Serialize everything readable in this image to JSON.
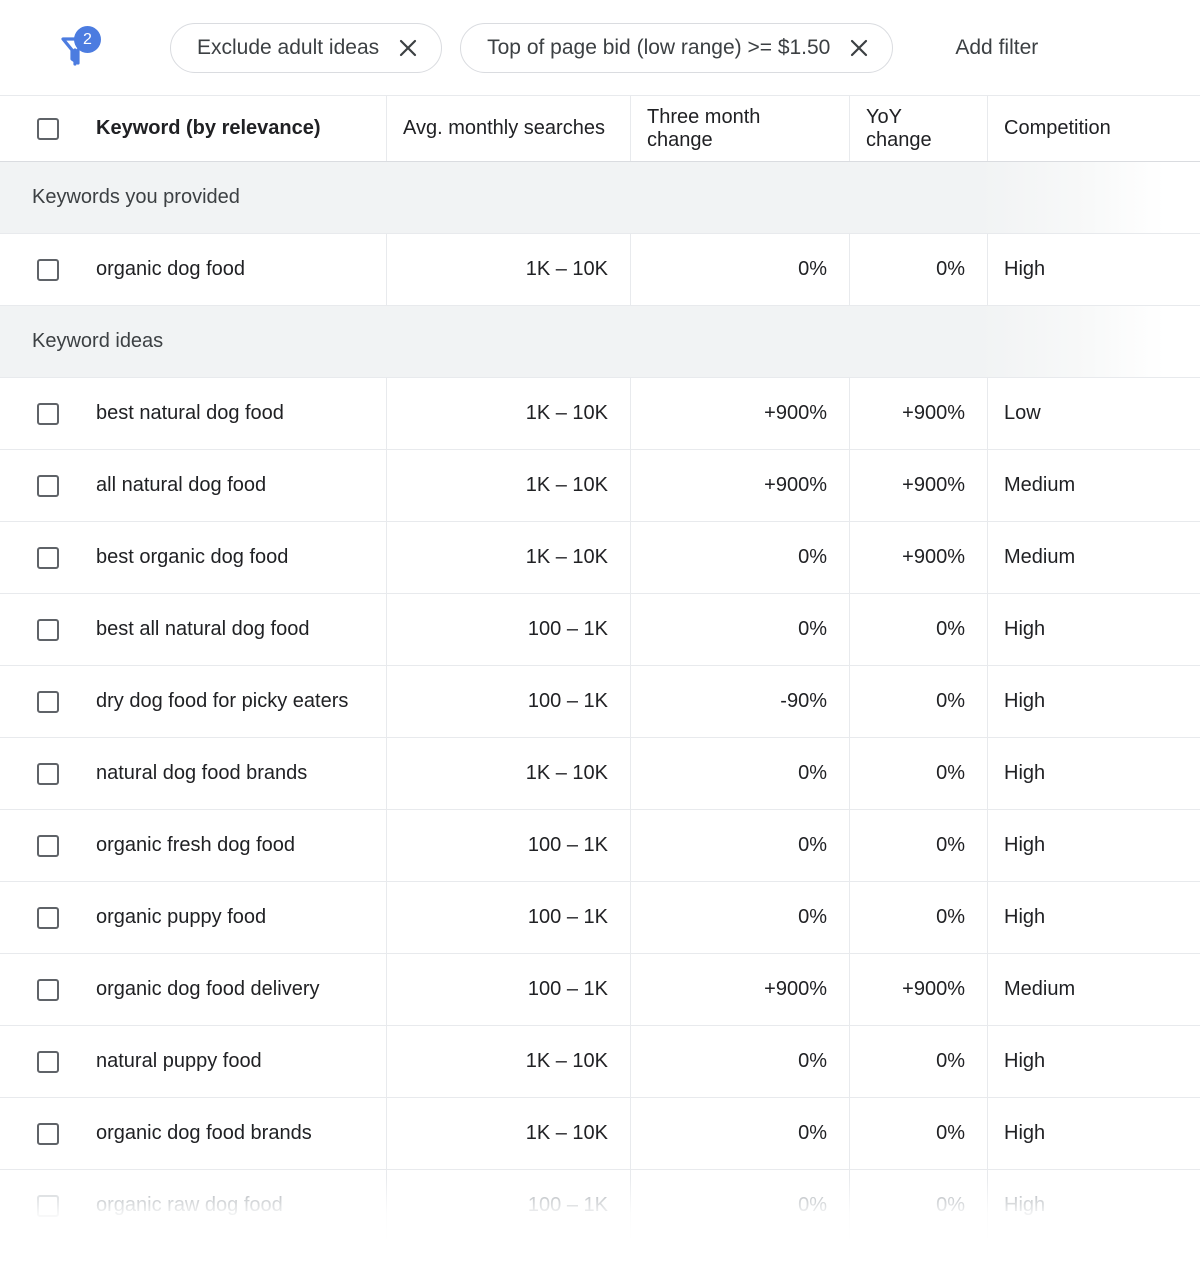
{
  "filter_bar": {
    "filter_icon": "filter-funnel-icon",
    "filter_count": "2",
    "chips": [
      {
        "label": "Exclude adult ideas",
        "remove_icon": "close-icon"
      },
      {
        "label": "Top of page bid (low range) >= $1.50",
        "remove_icon": "close-icon"
      }
    ],
    "add_filter_label": "Add filter"
  },
  "table": {
    "columns": [
      "Keyword (by relevance)",
      "Avg. monthly searches",
      "Three month change",
      "YoY change",
      "Competition"
    ],
    "groups": [
      {
        "label": "Keywords you provided",
        "rows": [
          {
            "keyword": "organic dog food",
            "searches": "1K – 10K",
            "three_month": "0%",
            "yoy": "0%",
            "competition": "High",
            "faded": false
          }
        ]
      },
      {
        "label": "Keyword ideas",
        "rows": [
          {
            "keyword": "best natural dog food",
            "searches": "1K – 10K",
            "three_month": "+900%",
            "yoy": "+900%",
            "competition": "Low",
            "faded": false
          },
          {
            "keyword": "all natural dog food",
            "searches": "1K – 10K",
            "three_month": "+900%",
            "yoy": "+900%",
            "competition": "Medium",
            "faded": false
          },
          {
            "keyword": "best organic dog food",
            "searches": "1K – 10K",
            "three_month": "0%",
            "yoy": "+900%",
            "competition": "Medium",
            "faded": false
          },
          {
            "keyword": "best all natural dog food",
            "searches": "100 – 1K",
            "three_month": "0%",
            "yoy": "0%",
            "competition": "High",
            "faded": false
          },
          {
            "keyword": "dry dog food for picky eaters",
            "searches": "100 – 1K",
            "three_month": "-90%",
            "yoy": "0%",
            "competition": "High",
            "faded": false
          },
          {
            "keyword": "natural dog food brands",
            "searches": "1K – 10K",
            "three_month": "0%",
            "yoy": "0%",
            "competition": "High",
            "faded": false
          },
          {
            "keyword": "organic fresh dog food",
            "searches": "100 – 1K",
            "three_month": "0%",
            "yoy": "0%",
            "competition": "High",
            "faded": false
          },
          {
            "keyword": "organic puppy food",
            "searches": "100 – 1K",
            "three_month": "0%",
            "yoy": "0%",
            "competition": "High",
            "faded": false
          },
          {
            "keyword": "organic dog food delivery",
            "searches": "100 – 1K",
            "three_month": "+900%",
            "yoy": "+900%",
            "competition": "Medium",
            "faded": false
          },
          {
            "keyword": "natural puppy food",
            "searches": "1K – 10K",
            "three_month": "0%",
            "yoy": "0%",
            "competition": "High",
            "faded": false
          },
          {
            "keyword": "organic dog food brands",
            "searches": "1K – 10K",
            "three_month": "0%",
            "yoy": "0%",
            "competition": "High",
            "faded": false
          },
          {
            "keyword": "organic raw dog food",
            "searches": "100 – 1K",
            "three_month": "0%",
            "yoy": "0%",
            "competition": "High",
            "faded": true
          }
        ]
      }
    ]
  },
  "colors": {
    "accent_blue": "#4c7ce0",
    "text_primary": "#202124",
    "text_secondary": "#3c4043",
    "text_muted": "#9aa0a6",
    "border": "#e8eaed",
    "chip_border": "#dadce0",
    "group_band": "#f1f3f4"
  }
}
